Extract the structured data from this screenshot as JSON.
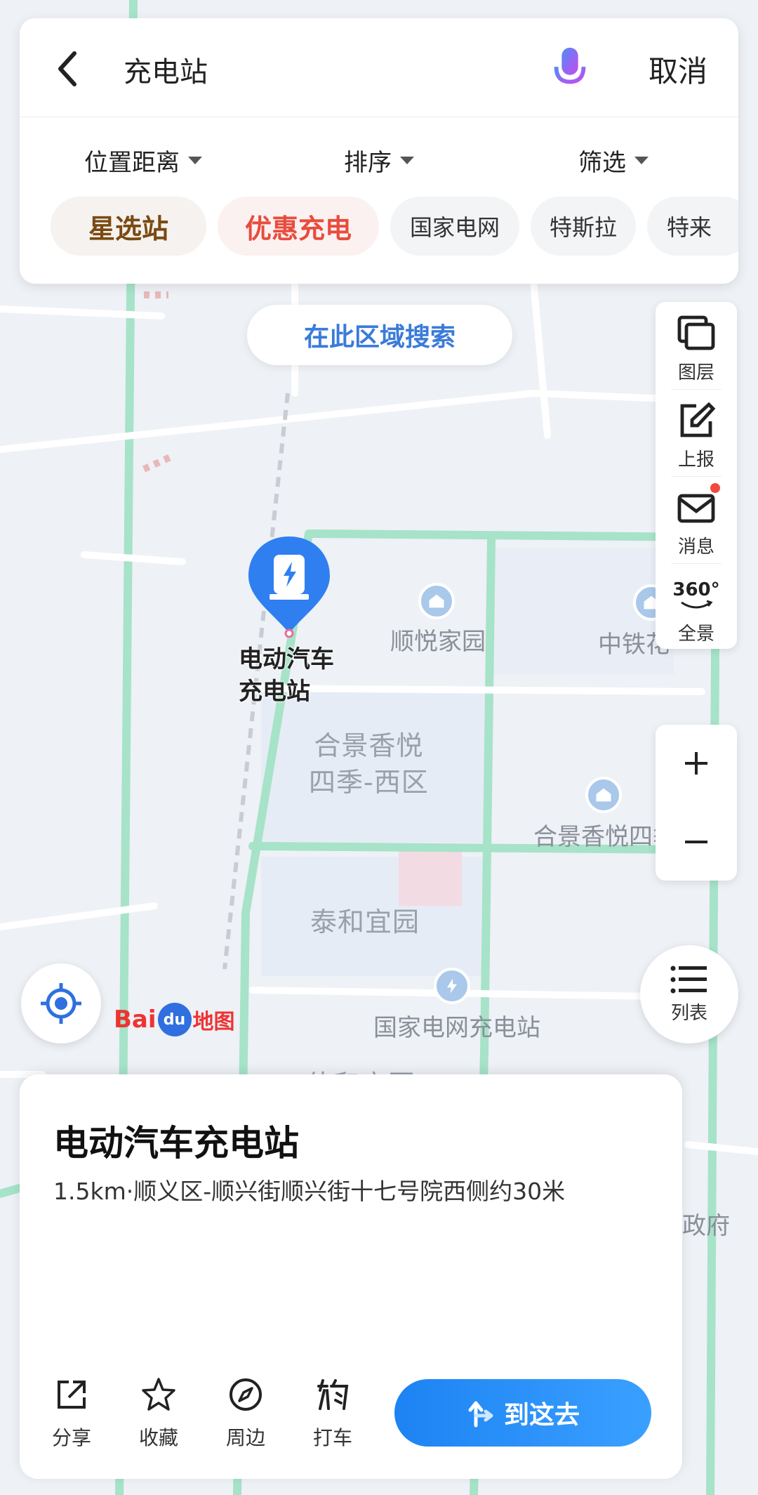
{
  "search": {
    "query": "充电站",
    "cancel_label": "取消"
  },
  "filters": [
    {
      "label": "位置距离"
    },
    {
      "label": "排序"
    },
    {
      "label": "筛选"
    }
  ],
  "chips": [
    {
      "label": "星选站"
    },
    {
      "label": "优惠充电"
    },
    {
      "label": "国家电网"
    },
    {
      "label": "特斯拉"
    },
    {
      "label": "特来"
    }
  ],
  "area_search_label": "在此区域搜索",
  "tools": {
    "layers": "图层",
    "report": "上报",
    "messages": "消息",
    "panorama": "全景",
    "panorama_badge": "360°"
  },
  "zoom": {
    "in": "+",
    "out": "−"
  },
  "list_label": "列表",
  "logo": {
    "bai": "Bai",
    "du": "du",
    "ditu": "地图"
  },
  "map_labels": {
    "shunyue": "顺悦家园",
    "zhongtie": "中铁花",
    "hejing_west": "合景香悦\n四季-西区",
    "hejing_east": "合景香悦四季",
    "taihe": "泰和宜园",
    "grid_station": "国家电网充电站",
    "zhenfu": "政府",
    "jiahe": "佳和宜园"
  },
  "marker": {
    "label_line1": "电动汽车",
    "label_line2": "充电站"
  },
  "card": {
    "title": "电动汽车充电站",
    "address": "1.5km·顺义区-顺兴街顺兴街十七号院西侧约30米",
    "actions": [
      {
        "label": "分享"
      },
      {
        "label": "收藏"
      },
      {
        "label": "周边"
      },
      {
        "label": "打车"
      }
    ],
    "go_label": "到这去"
  },
  "colors": {
    "accent": "#3b7bd9",
    "go_button": "#1d83f3",
    "road": "#9ee0c4",
    "map_bg": "#eef1f6"
  }
}
